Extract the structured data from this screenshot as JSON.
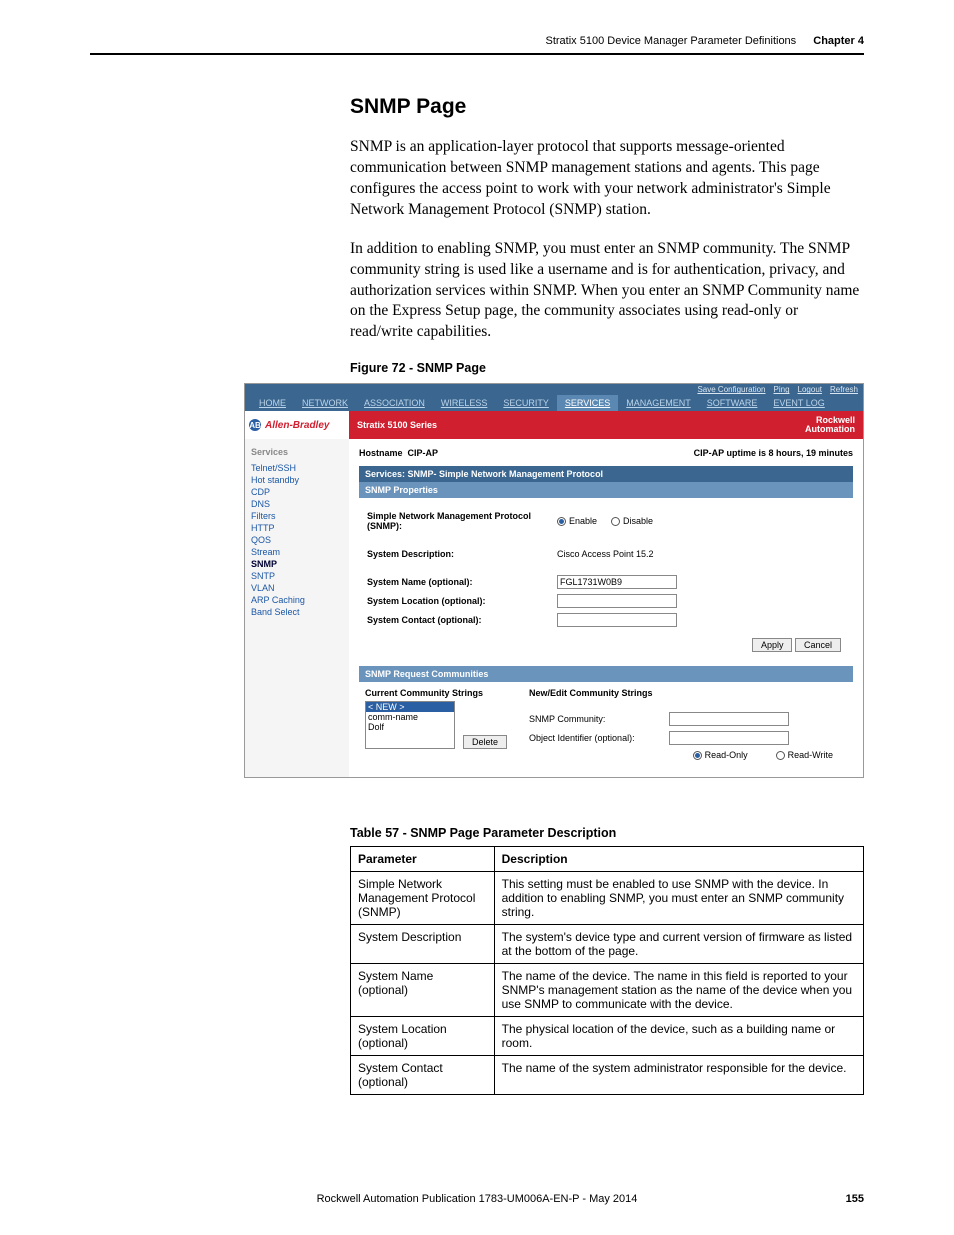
{
  "running_head": {
    "title": "Stratix 5100 Device Manager Parameter Definitions",
    "chapter": "Chapter 4"
  },
  "section_title": "SNMP Page",
  "para1": "SNMP is an application-layer protocol that supports message-oriented communication between SNMP management stations and agents. This page configures the access point to work with your network administrator's Simple Network Management Protocol (SNMP) station.",
  "para2": "In addition to enabling SNMP, you must enter an SNMP community. The SNMP community string is used like a username and is for authentication, privacy, and authorization services within SNMP. When you enter an SNMP Community name on the Express Setup page, the community associates using read-only or read/write capabilities.",
  "figure_caption": "Figure 72 - SNMP Page",
  "shot": {
    "top_links": [
      "Save Configuration",
      "Ping",
      "Logout",
      "Refresh"
    ],
    "menu": [
      "HOME",
      "NETWORK",
      "ASSOCIATION",
      "WIRELESS",
      "SECURITY",
      "SERVICES",
      "MANAGEMENT",
      "SOFTWARE",
      "EVENT LOG"
    ],
    "menu_active_index": 5,
    "ab_brand": "Allen-Bradley",
    "title": "Stratix 5100 Series",
    "ra_line1": "Rockwell",
    "ra_line2": "Automation",
    "sidebar_header": "Services",
    "sidebar_items": [
      "Telnet/SSH",
      "Hot standby",
      "CDP",
      "DNS",
      "Filters",
      "HTTP",
      "QOS",
      "Stream",
      "SNMP",
      "SNTP",
      "VLAN",
      "ARP Caching",
      "Band Select"
    ],
    "hostname_label": "Hostname",
    "hostname_value": "CIP-AP",
    "uptime": "CIP-AP uptime is 8 hours, 19 minutes",
    "panel_services_title": "Services: SNMP- Simple Network Management Protocol",
    "panel_props_title": "SNMP Properties",
    "snmp_proto_label": "Simple Network Management Protocol (SNMP):",
    "enable": "Enable",
    "disable": "Disable",
    "sys_desc_label": "System Description:",
    "sys_desc_value": "Cisco Access Point 15.2",
    "sys_name_label": "System Name (optional):",
    "sys_name_value": "FGL1731W0B9",
    "sys_loc_label": "System Location (optional):",
    "sys_contact_label": "System Contact (optional):",
    "apply": "Apply",
    "cancel": "Cancel",
    "panel_comm_title": "SNMP Request Communities",
    "cur_comm_header": "Current Community Strings",
    "comm_list": [
      "< NEW >",
      "comm-name",
      "Dolf"
    ],
    "delete": "Delete",
    "new_comm_header": "New/Edit Community Strings",
    "snmp_community_label": "SNMP Community:",
    "obj_id_label": "Object Identifier (optional):",
    "readonly": "Read-Only",
    "readwrite": "Read-Write"
  },
  "table_caption": "Table 57 - SNMP Page Parameter Description",
  "table_headers": {
    "param": "Parameter",
    "desc": "Description"
  },
  "table_rows": [
    {
      "p": "Simple Network Management Protocol (SNMP)",
      "d": "This setting must be enabled to use SNMP with the device. In addition to enabling SNMP, you must enter an SNMP community string."
    },
    {
      "p": "System Description",
      "d": "The system's device type and current version of firmware as listed at the bottom of the page."
    },
    {
      "p": "System Name (optional)",
      "d": "The name of the device. The name in this field is reported to your SNMP's management station as the name of the device when you use SNMP to communicate with the device."
    },
    {
      "p": "System Location (optional)",
      "d": "The physical location of the device, such as a building name or room."
    },
    {
      "p": "System Contact (optional)",
      "d": "The name of the system administrator responsible for the device."
    }
  ],
  "footer_pub": "Rockwell Automation Publication 1783-UM006A-EN-P - May 2014",
  "footer_page": "155"
}
